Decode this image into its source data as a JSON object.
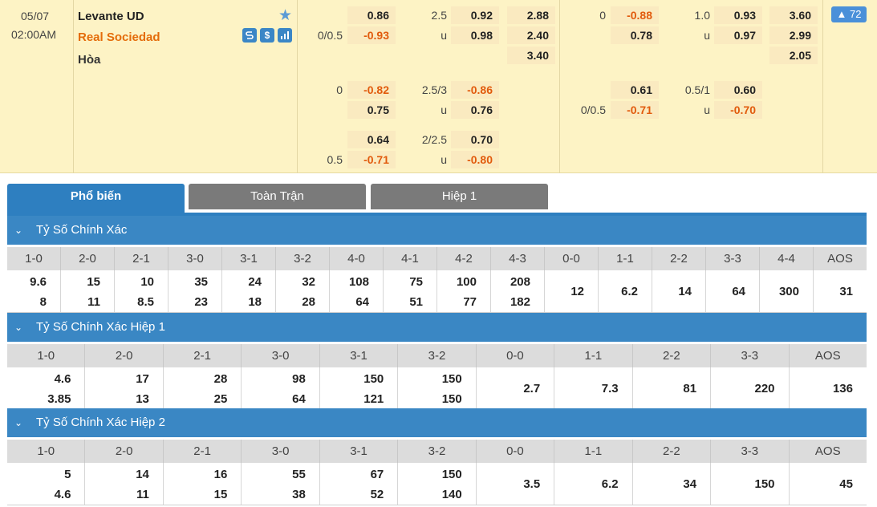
{
  "match": {
    "date": "05/07",
    "time": "02:00AM",
    "home": "Levante UD",
    "away": "Real Sociedad",
    "draw": "Hòa",
    "more_count": "72",
    "icons": [
      "star-icon",
      "s-icon",
      "dollar-icon",
      "chart-icon"
    ]
  },
  "odds": {
    "ah_ft_1": {
      "hdp": "0/0.5",
      "home": "0.86",
      "away": "-0.93"
    },
    "ou_ft_1": {
      "line": "2.5",
      "u": "u",
      "over": "0.92",
      "under": "0.98"
    },
    "x12_ft": {
      "h": "2.88",
      "a": "2.40",
      "d": "3.40"
    },
    "ah_ft_2": {
      "hdp": "0",
      "home": "-0.82",
      "away": "0.75"
    },
    "ou_ft_2": {
      "line": "2.5/3",
      "u": "u",
      "over": "-0.86",
      "under": "0.76"
    },
    "ah_ft_3": {
      "hdp": "0.5",
      "home": "0.64",
      "away": "-0.71"
    },
    "ou_ft_3": {
      "line": "2/2.5",
      "u": "u",
      "over": "0.70",
      "under": "-0.80"
    },
    "ah_h1_1": {
      "hdp": "0",
      "home": "-0.88",
      "away": "0.78"
    },
    "ou_h1_1": {
      "line": "1.0",
      "u": "u",
      "over": "0.93",
      "under": "0.97"
    },
    "x12_h1": {
      "h": "3.60",
      "a": "2.99",
      "d": "2.05"
    },
    "ah_h1_2": {
      "hdp": "0/0.5",
      "home": "0.61",
      "away": "-0.71"
    },
    "ou_h1_2": {
      "line": "0.5/1",
      "u": "u",
      "over": "0.60",
      "under": "-0.70"
    }
  },
  "tabs": [
    "Phổ biến",
    "Toàn Trận",
    "Hiệp 1"
  ],
  "sections": [
    {
      "title": "Tỷ Số Chính Xác",
      "labels": [
        "1-0",
        "2-0",
        "2-1",
        "3-0",
        "3-1",
        "3-2",
        "4-0",
        "4-1",
        "4-2",
        "4-3",
        "0-0",
        "1-1",
        "2-2",
        "3-3",
        "4-4",
        "AOS"
      ],
      "top": [
        "9.6",
        "15",
        "10",
        "35",
        "24",
        "32",
        "108",
        "75",
        "100",
        "208",
        "",
        "",
        "",
        "",
        "",
        ""
      ],
      "bottom": [
        "8",
        "11",
        "8.5",
        "23",
        "18",
        "28",
        "64",
        "51",
        "77",
        "182",
        "",
        "",
        "",
        "",
        "",
        ""
      ],
      "single": [
        "",
        "",
        "",
        "",
        "",
        "",
        "",
        "",
        "",
        "",
        "12",
        "6.2",
        "14",
        "64",
        "300",
        "31"
      ]
    },
    {
      "title": "Tỷ Số Chính Xác Hiệp 1",
      "labels": [
        "1-0",
        "2-0",
        "2-1",
        "3-0",
        "3-1",
        "3-2",
        "0-0",
        "1-1",
        "2-2",
        "3-3",
        "AOS"
      ],
      "top": [
        "4.6",
        "17",
        "28",
        "98",
        "150",
        "150",
        "",
        "",
        "",
        "",
        ""
      ],
      "bottom": [
        "3.85",
        "13",
        "25",
        "64",
        "121",
        "150",
        "",
        "",
        "",
        "",
        ""
      ],
      "single": [
        "",
        "",
        "",
        "",
        "",
        "",
        "2.7",
        "7.3",
        "81",
        "220",
        "136"
      ]
    },
    {
      "title": "Tỷ Số Chính Xác Hiệp 2",
      "labels": [
        "1-0",
        "2-0",
        "2-1",
        "3-0",
        "3-1",
        "3-2",
        "0-0",
        "1-1",
        "2-2",
        "3-3",
        "AOS"
      ],
      "top": [
        "5",
        "14",
        "16",
        "55",
        "67",
        "150",
        "",
        "",
        "",
        "",
        ""
      ],
      "bottom": [
        "4.6",
        "11",
        "15",
        "38",
        "52",
        "140",
        "",
        "",
        "",
        "",
        ""
      ],
      "single": [
        "",
        "",
        "",
        "",
        "",
        "",
        "3.5",
        "6.2",
        "34",
        "150",
        "45"
      ]
    }
  ]
}
